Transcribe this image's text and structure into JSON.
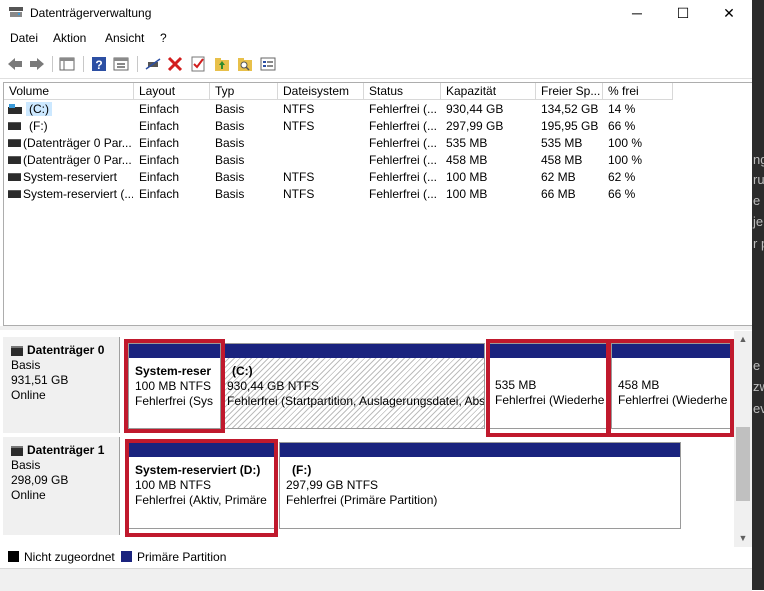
{
  "window": {
    "title": "Datenträgerverwaltung",
    "minimize_glyph": "─",
    "maximize_glyph": "☐",
    "close_glyph": "✕"
  },
  "menu": [
    "Datei",
    "Aktion",
    "Ansicht",
    "?"
  ],
  "toolbar_icons": [
    "back-arrow-icon",
    "forward-arrow-icon",
    "console-tree-icon",
    "help-icon",
    "properties-icon",
    "connect-icon",
    "delete-icon",
    "checklist-icon",
    "folder-up-icon",
    "folder-search-icon",
    "list-view-icon"
  ],
  "volume_table": {
    "columns": [
      "Volume",
      "Layout",
      "Typ",
      "Dateisystem",
      "Status",
      "Kapazität",
      "Freier Sp...",
      "% frei"
    ],
    "rows": [
      [
        "(C:)",
        "Einfach",
        "Basis",
        "NTFS",
        "Fehlerfrei (...",
        "930,44 GB",
        "134,52 GB",
        "14 %"
      ],
      [
        "(F:)",
        "Einfach",
        "Basis",
        "NTFS",
        "Fehlerfrei (...",
        "297,99 GB",
        "195,95 GB",
        "66 %"
      ],
      [
        "(Datenträger 0 Par...",
        "Einfach",
        "Basis",
        "",
        "Fehlerfrei (...",
        "535 MB",
        "535 MB",
        "100 %"
      ],
      [
        "(Datenträger 0 Par...",
        "Einfach",
        "Basis",
        "",
        "Fehlerfrei (...",
        "458 MB",
        "458 MB",
        "100 %"
      ],
      [
        "System-reserviert",
        "Einfach",
        "Basis",
        "NTFS",
        "Fehlerfrei (...",
        "100 MB",
        "62 MB",
        "62 %"
      ],
      [
        "System-reserviert (...",
        "Einfach",
        "Basis",
        "NTFS",
        "Fehlerfrei (...",
        "100 MB",
        "66 MB",
        "66 %"
      ]
    ]
  },
  "disks": [
    {
      "name": "Datenträger 0",
      "type": "Basis",
      "size": "931,51 GB",
      "state": "Online",
      "partitions": [
        {
          "title": "System-reser",
          "size": "100 MB NTFS",
          "status": "Fehlerfrei (Sys"
        },
        {
          "title": "(C:)",
          "size": "930,44 GB NTFS",
          "status": "Fehlerfrei (Startpartition, Auslagerungsdatei, Abs"
        },
        {
          "title": "",
          "size": "535 MB",
          "status": "Fehlerfrei (Wiederhe"
        },
        {
          "title": "",
          "size": "458 MB",
          "status": "Fehlerfrei (Wiederhe"
        }
      ]
    },
    {
      "name": "Datenträger 1",
      "type": "Basis",
      "size": "298,09 GB",
      "state": "Online",
      "partitions": [
        {
          "title": "System-reserviert  (D:)",
          "size": "100 MB NTFS",
          "status": "Fehlerfrei (Aktiv, Primäre"
        },
        {
          "title": "(F:)",
          "size": "297,99 GB NTFS",
          "status": "Fehlerfrei (Primäre Partition)"
        }
      ]
    }
  ],
  "legend": [
    {
      "label": "Nicht zugeordnet",
      "color": "#000000"
    },
    {
      "label": "Primäre Partition",
      "color": "#1a237e"
    }
  ],
  "colors": {
    "highlight": "#c0192d",
    "partition_band": "#1a237e"
  },
  "right_strip_fragments": [
    "ng",
    "ru",
    "e",
    "je",
    "r p",
    "e",
    "zw",
    "ev"
  ]
}
